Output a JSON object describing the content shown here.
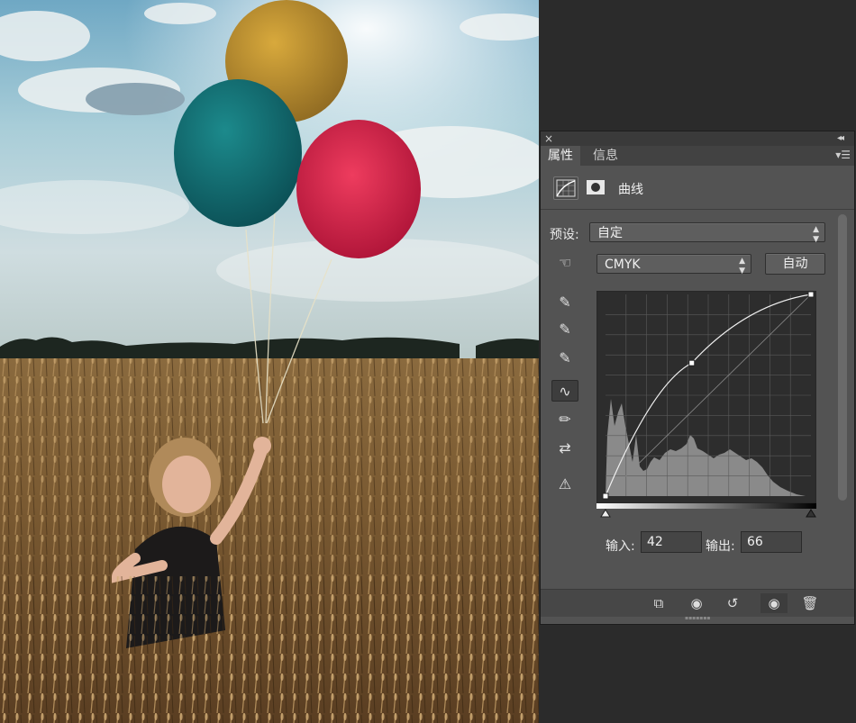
{
  "panel": {
    "close_glyph": "×",
    "collapse_glyph": "◂◂",
    "tabs": [
      {
        "label": "属性",
        "active": true
      },
      {
        "label": "信息",
        "active": false
      }
    ],
    "tab_menu_icon": "panel-menu-icon",
    "header_title": "曲线",
    "preset_label": "预设:",
    "preset_value": "自定",
    "channel_value": "CMYK",
    "auto_button": "自动",
    "input_label": "输入:",
    "input_value": "42",
    "output_label": "输出:",
    "output_value": "66"
  },
  "curve": {
    "points": [
      [
        0,
        0
      ],
      [
        42,
        66
      ],
      [
        100,
        100
      ]
    ],
    "selected_point": [
      42,
      66
    ]
  },
  "colors": {
    "panel_bg": "#535353",
    "tab_bar_bg": "#424242",
    "workspace_bg": "#2b2b2b"
  }
}
